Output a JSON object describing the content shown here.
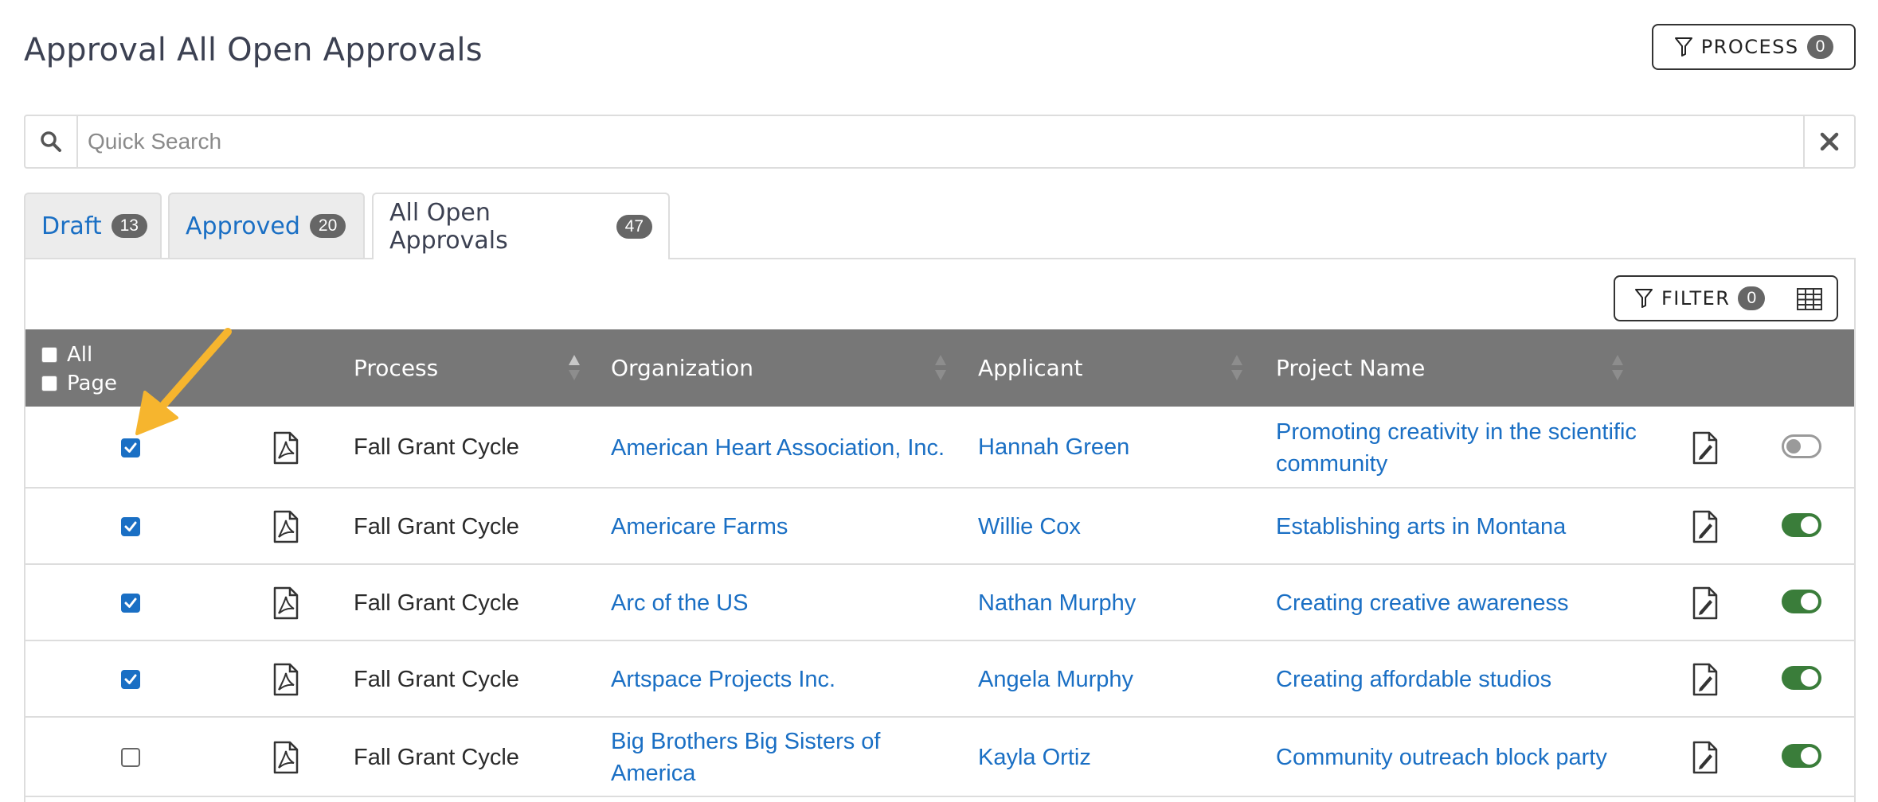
{
  "page": {
    "title": "Approval All Open Approvals",
    "process_button": {
      "label": "PROCESS",
      "count": "0"
    }
  },
  "search": {
    "placeholder": "Quick Search",
    "value": ""
  },
  "tabs": [
    {
      "label": "Draft",
      "count": "13",
      "active": false
    },
    {
      "label": "Approved",
      "count": "20",
      "active": false
    },
    {
      "label": "All Open Approvals",
      "count": "47",
      "active": true
    }
  ],
  "toolbar": {
    "filter_label": "FILTER",
    "filter_count": "0"
  },
  "table": {
    "select_all_label": "All",
    "select_page_label": "Page",
    "columns": [
      "Process",
      "Organization",
      "Applicant",
      "Project Name"
    ],
    "rows": [
      {
        "checked": true,
        "process": "Fall Grant Cycle",
        "organization": [
          "American Heart Association, Inc."
        ],
        "applicant": "Hannah Green",
        "project": [
          "Promoting creativity in the scientific",
          "community"
        ],
        "enabled": false
      },
      {
        "checked": true,
        "process": "Fall Grant Cycle",
        "organization": [
          "Americare Farms"
        ],
        "applicant": "Willie Cox",
        "project": [
          "Establishing arts in Montana"
        ],
        "enabled": true
      },
      {
        "checked": true,
        "process": "Fall Grant Cycle",
        "organization": [
          "Arc of the US"
        ],
        "applicant": "Nathan Murphy",
        "project": [
          "Creating creative awareness"
        ],
        "enabled": true
      },
      {
        "checked": true,
        "process": "Fall Grant Cycle",
        "organization": [
          "Artspace Projects Inc."
        ],
        "applicant": "Angela Murphy",
        "project": [
          "Creating affordable studios"
        ],
        "enabled": true
      },
      {
        "checked": false,
        "process": "Fall Grant Cycle",
        "organization": [
          "Big Brothers Big Sisters of",
          "America"
        ],
        "applicant": "Kayla Ortiz",
        "project": [
          "Community outreach block party"
        ],
        "enabled": true
      }
    ]
  },
  "colors": {
    "link": "#1a6fc4",
    "header_bg": "#777777",
    "toggle_on": "#3a7d3a",
    "arrow": "#f6b52e"
  }
}
